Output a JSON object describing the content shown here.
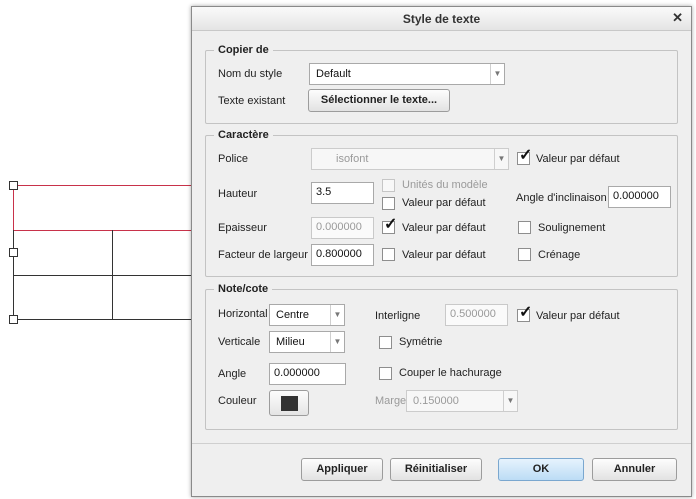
{
  "dialog": {
    "title": "Style de texte",
    "close_icon": "close-icon"
  },
  "copier": {
    "legend": "Copier de",
    "nom_label": "Nom du style",
    "nom_value": "Default",
    "existant_label": "Texte existant",
    "select_button": "Sélectionner le texte..."
  },
  "caractere": {
    "legend": "Caractère",
    "police_label": "Police",
    "police_value": "isofont",
    "police_default_label": "Valeur par défaut",
    "police_default_checked": true,
    "hauteur_label": "Hauteur",
    "hauteur_value": "3.5",
    "unites_label": "Unités du modèle",
    "hauteur_default_label": "Valeur par défaut",
    "angle_label": "Angle d'inclinaison",
    "angle_value": "0.000000",
    "epaisseur_label": "Epaisseur",
    "epaisseur_value": "0.000000",
    "epaisseur_default_label": "Valeur par défaut",
    "epaisseur_default_checked": true,
    "soulignement_label": "Soulignement",
    "facteur_label": "Facteur de largeur",
    "facteur_value": "0.800000",
    "facteur_default_label": "Valeur par défaut",
    "crenage_label": "Crénage"
  },
  "note": {
    "legend": "Note/cote",
    "horizontal_label": "Horizontal",
    "horizontal_value": "Centre",
    "interligne_label": "Interligne",
    "interligne_value": "0.500000",
    "interligne_default_label": "Valeur par défaut",
    "interligne_default_checked": true,
    "verticale_label": "Verticale",
    "verticale_value": "Milieu",
    "symetrie_label": "Symétrie",
    "angle_label": "Angle",
    "angle_value": "0.000000",
    "couper_label": "Couper le hachurage",
    "couleur_label": "Couleur",
    "couleur_value": "#333333",
    "marge_label": "Marge",
    "marge_value": "0.150000"
  },
  "footer": {
    "appliquer": "Appliquer",
    "reinitialiser": "Réinitialiser",
    "ok": "OK",
    "annuler": "Annuler"
  },
  "colors": {
    "drawing_red": "#c8324a",
    "drawing_black": "#333333",
    "primary_button": "#bcdcf5"
  }
}
